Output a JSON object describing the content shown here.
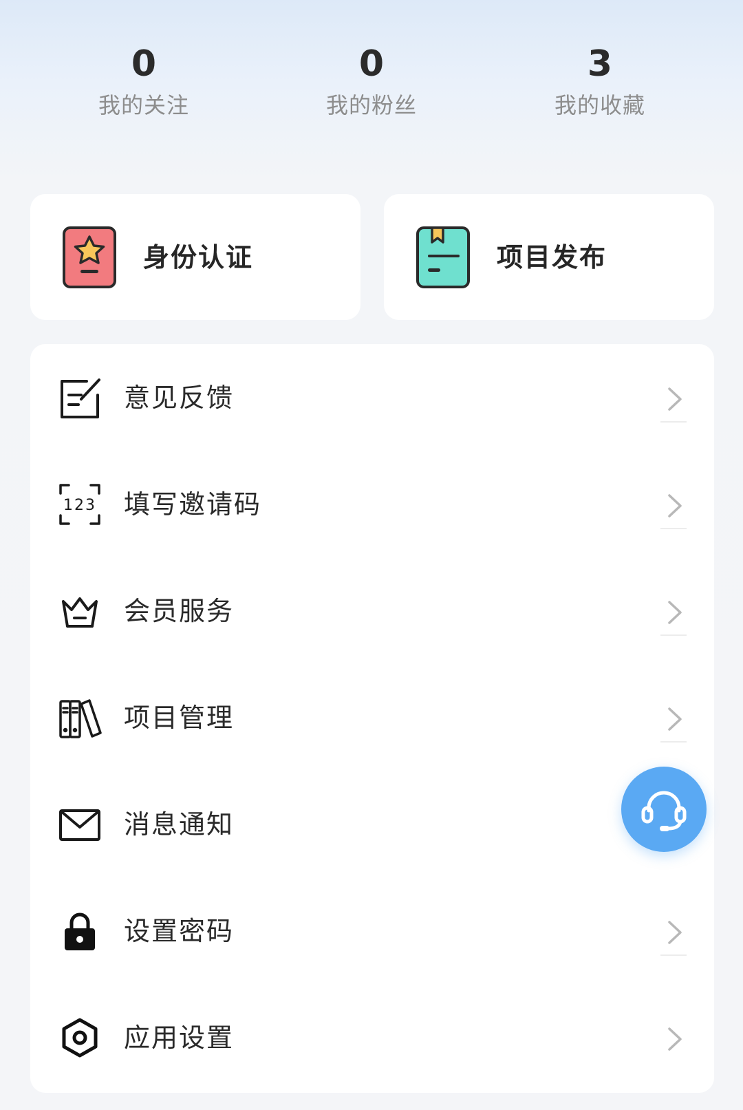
{
  "stats": [
    {
      "value": "0",
      "label": "我的关注"
    },
    {
      "value": "0",
      "label": "我的粉丝"
    },
    {
      "value": "3",
      "label": "我的收藏"
    }
  ],
  "quick_actions": [
    {
      "label": "身份认证",
      "icon": "id-card-star-icon",
      "color": "#f27b7f"
    },
    {
      "label": "项目发布",
      "icon": "bookmark-doc-icon",
      "color": "#6fe0cf"
    }
  ],
  "menu": [
    {
      "label": "意见反馈",
      "icon": "edit-note-icon"
    },
    {
      "label": "填写邀请码",
      "icon": "code-123-icon"
    },
    {
      "label": "会员服务",
      "icon": "crown-icon"
    },
    {
      "label": "项目管理",
      "icon": "books-icon"
    },
    {
      "label": "消息通知",
      "icon": "mail-icon"
    },
    {
      "label": "设置密码",
      "icon": "lock-icon"
    },
    {
      "label": "应用设置",
      "icon": "hex-gear-icon"
    }
  ],
  "support_button": {
    "icon": "headset-icon",
    "color": "#5aa9f3"
  }
}
